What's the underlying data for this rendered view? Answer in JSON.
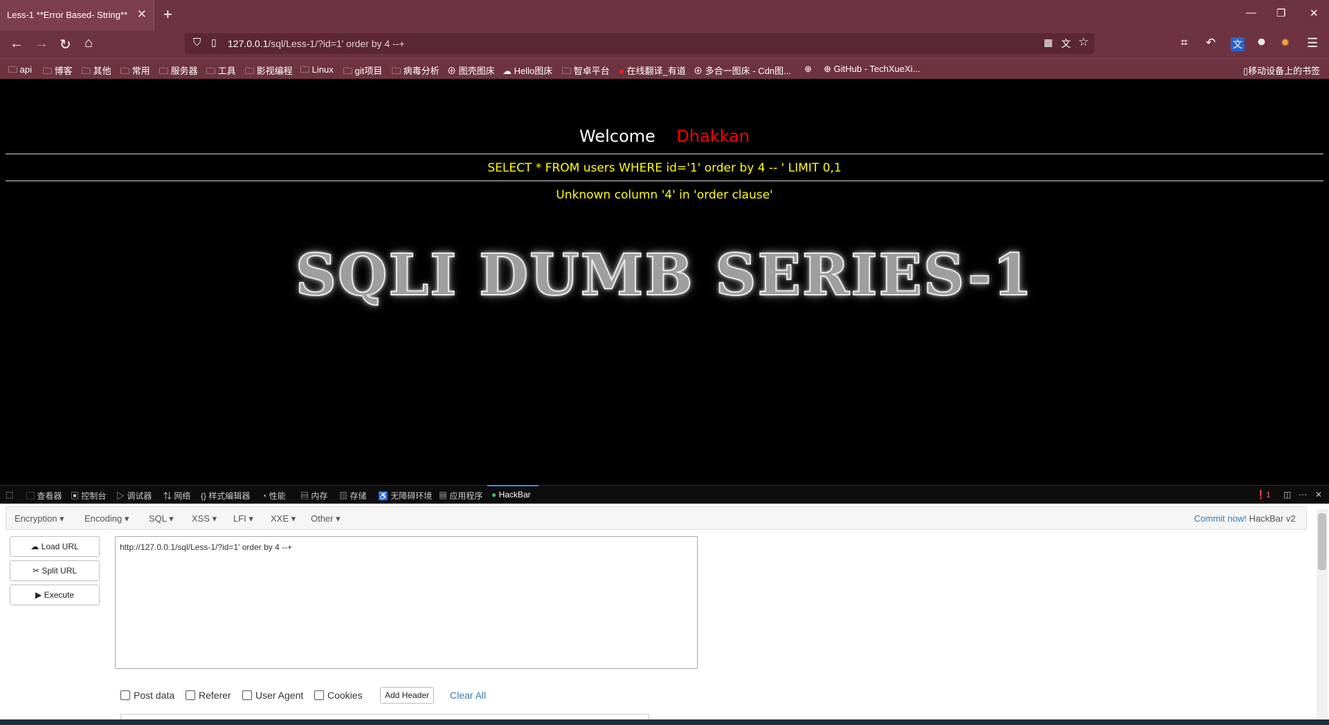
{
  "browser": {
    "tab_title": "Less-1 **Error Based- String**",
    "url_host": "127.0.0.1",
    "url_rest": "/sql/Less-1/?id=1' order by 4 --+",
    "bookmarks": [
      "api",
      "博客",
      "其他",
      "常用",
      "服务器",
      "工具",
      "影视编程",
      "Linux",
      "git项目",
      "病毒分析",
      "图壳图床",
      "Hello图床",
      "智卓平台",
      "在线翻译_有道",
      "多合一图床 - Cdn图...",
      "GitHub - TechXueXi...",
      "移动设备上的书签"
    ]
  },
  "page": {
    "welcome": "Welcome",
    "name": "Dhakkan",
    "query": "SELECT * FROM users WHERE id='1' order by 4 -- ' LIMIT 0,1",
    "error": "Unknown column '4' in 'order clause'",
    "logo": "SQLI DUMB SERIES-1"
  },
  "devtools": {
    "tabs": [
      "查看器",
      "控制台",
      "调试器",
      "网络",
      "样式编辑器",
      "性能",
      "内存",
      "存储",
      "无障碍环境",
      "应用程序",
      "HackBar"
    ],
    "error_count": "1"
  },
  "hackbar": {
    "menus": [
      "Encryption",
      "Encoding",
      "SQL",
      "XSS",
      "LFI",
      "XXE",
      "Other"
    ],
    "commit": "Commit now!",
    "version": "HackBar v2",
    "load_url": "Load URL",
    "split_url": "Split URL",
    "execute": "Execute",
    "url_value": "http://127.0.0.1/sql/Less-1/?id=1' order by 4 --+",
    "post_data": "Post data",
    "referer": "Referer",
    "user_agent": "User Agent",
    "cookies": "Cookies",
    "add_header": "Add Header",
    "clear_all": "Clear All"
  },
  "colors": {
    "chrome": "#6e3341",
    "name_red": "#ff0000",
    "sql_yellow": "#ffff00",
    "link_blue": "#337ab7"
  }
}
